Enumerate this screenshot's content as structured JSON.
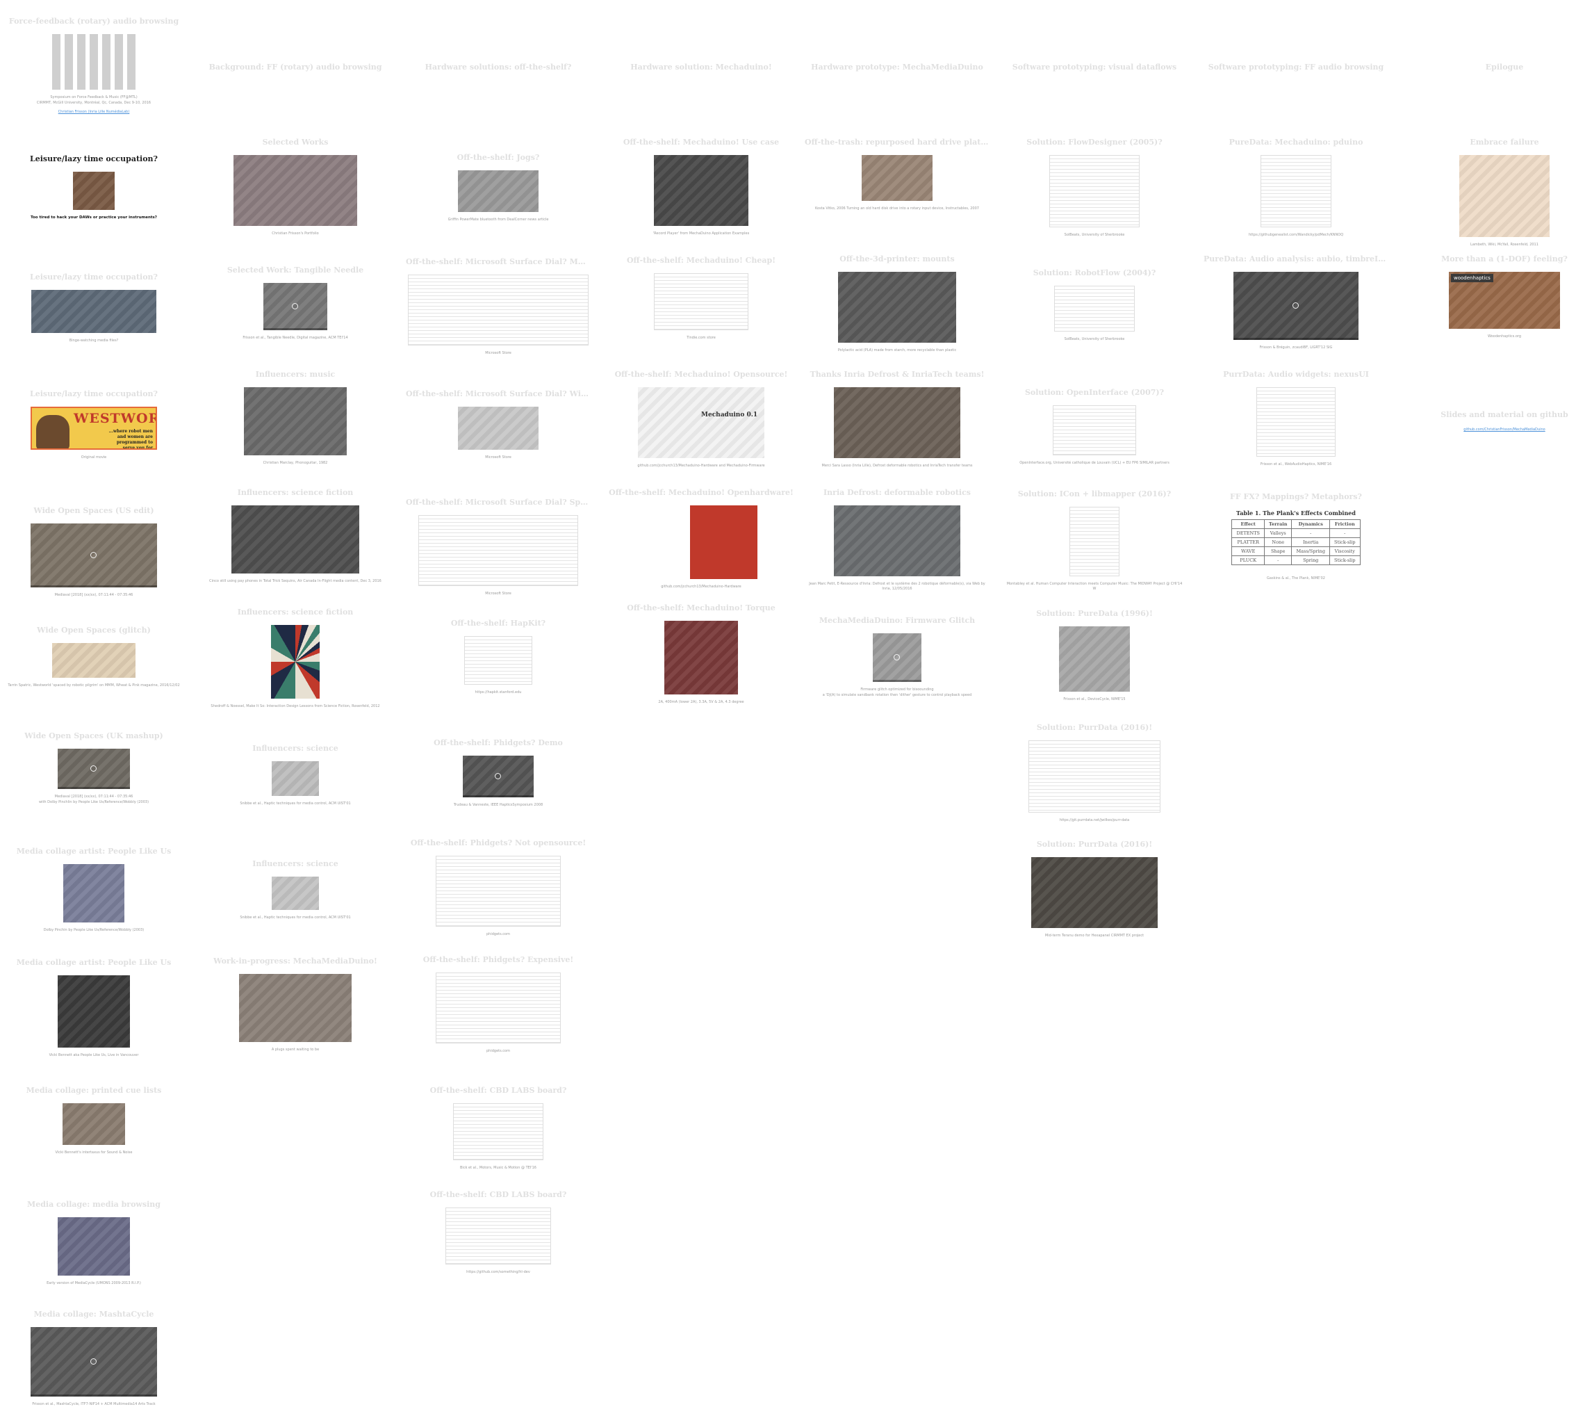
{
  "columns": [
    {
      "key": "c0",
      "cells": [
        {
          "title": "Force-feedback (rotary) audio browsing",
          "thumb": {
            "kind": "grid",
            "color": "#b8b8b8"
          },
          "caption": "Symposium on Force Feedback & Music (FF@MTL)",
          "caption2": "CIRMMT, McGill University, Montréal, Qc, Canada, Dec 9-10, 2016",
          "caption3": "Christian Frisson (Inria Lille NumédiaLab)"
        },
        {
          "title": "Leisure/lazy time occupation?",
          "title_dark": true,
          "thumb": {
            "kind": "photo",
            "color": "#7a5a44"
          },
          "caption": "Too tired to hack your DAWs or practice your instruments?",
          "caption_dark": true
        },
        {
          "title": "Leisure/lazy time occupation?",
          "thumb": {
            "kind": "photo",
            "color": "#5e6a78"
          },
          "caption": "Binge-watching media files?"
        },
        {
          "title": "Leisure/lazy time occupation?",
          "thumb": {
            "kind": "westworld",
            "color": "#f2c94c"
          },
          "ww_title": "WESTWORLD",
          "ww_tagline": "...where robot men and women are programmed to serve you for ROMANCE VIOLENCE ...ANYTHING",
          "caption": "Original movie"
        },
        {
          "title": "Wide Open Spaces (US edit)",
          "thumb": {
            "kind": "video",
            "color": "#7d7467"
          },
          "caption": "Mediaval [2018] (xx/xx), 07:11:44 - 07:35:46"
        },
        {
          "title": "Wide Open Spaces (glitch)",
          "thumb": {
            "kind": "photo",
            "color": "#e0cfb4"
          },
          "caption": "Tarrin Spatric, Westworld 'spaced by robotic pilgrim' on MMM, Wheat & Pink magazine, 2016/12/02"
        },
        {
          "title": "Wide Open Spaces (UK mashup)",
          "thumb": {
            "kind": "video",
            "color": "#6f6a63"
          },
          "caption": "Mediaval [2018] (xx/xx), 07:11:44 - 07:35:46",
          "caption2": "with Dolby Pinchlin by People Like Us/Reference/Wobbly (2003)"
        },
        {
          "title": "Media collage artist: People Like Us",
          "thumb": {
            "kind": "photo",
            "color": "#7a7e9a"
          },
          "caption": "Dolby Pinchin by People Like Us/Reference/Wobbly (2003)"
        },
        {
          "title": "Media collage artist: People Like Us",
          "thumb": {
            "kind": "photo",
            "color": "#3b3b3b"
          },
          "caption": "Vicki Bennett aka People Like Us, Live in Vancouver"
        },
        {
          "title": "Media collage: printed cue lists",
          "thumb": {
            "kind": "photo",
            "color": "#8a7c70"
          },
          "caption": "Vicki Bennett's intertaxus for Sound & Noise"
        },
        {
          "title": "Media collage: media browsing",
          "thumb": {
            "kind": "photo",
            "color": "#6a6c88"
          },
          "caption": "Early version of MediaCycle (UMONS 2009-2013 R.I.P.)"
        },
        {
          "title": "Media collage: MashtaCycle",
          "thumb": {
            "kind": "video",
            "color": "#5a5a5a"
          },
          "caption": "Frisson et al., MashtaCycle, ITF7-NIF14 + ACM Multimedia14 Arts Track"
        }
      ]
    },
    {
      "key": "c1",
      "cells": [
        {
          "title": "Background: FF (rotary) audio browsing",
          "thumb": null,
          "caption": ""
        },
        {
          "title": "Selected Works",
          "thumb": {
            "kind": "collage",
            "color": "#8c7d80"
          },
          "caption": "Christian Frisson's Portfolio"
        },
        {
          "title": "Selected Work: Tangible Needle",
          "thumb": {
            "kind": "video",
            "color": "#777777"
          },
          "caption": "Frisson et al., Tangible Needle, Digital magazine, ACM TEI'14"
        },
        {
          "title": "Influencers: music",
          "thumb": {
            "kind": "photo",
            "color": "#6a6a6a"
          },
          "caption": "Christian Marclay, Phonoguitar, 1982"
        },
        {
          "title": "Influencers: science fiction",
          "thumb": {
            "kind": "photo",
            "color": "#4f4f4f"
          },
          "caption": "Cinco still using pay phones in Total Trick Sequins, Air Canada In-Flight media content, Dec 3, 2016"
        },
        {
          "title": "Influencers: science fiction",
          "thumb": {
            "kind": "burst",
            "color": "#c26a6a"
          },
          "caption": "Shedroff & Noessel, Make It So: Interaction Design Lessons from Science Fiction, Rosenfeld, 2012"
        },
        {
          "title": "Influencers: science",
          "thumb": {
            "kind": "photo",
            "color": "#bdbdbd"
          },
          "caption": "Snibbe et al., Haptic techniques for media control, ACM UIST'01"
        },
        {
          "title": "Influencers: science",
          "thumb": {
            "kind": "photo",
            "color": "#c4c4c4"
          },
          "caption": "Snibbe et al., Haptic techniques for media control, ACM UIST'01"
        },
        {
          "title": "Work-in-progress: MechaMediaDuino!",
          "thumb": {
            "kind": "photo",
            "color": "#8b8178"
          },
          "caption": "A plugs spent waiting to be"
        }
      ]
    },
    {
      "key": "c2",
      "cells": [
        {
          "title": "Hardware solutions: off-the-shelf?",
          "thumb": null,
          "caption": ""
        },
        {
          "title": "Off-the-shelf: Jogs?",
          "thumb": {
            "kind": "photo",
            "color": "#9a9a9a"
          },
          "caption": "Griffin PowerMate bluetooth from DealCorner news article"
        },
        {
          "title": "Off-the-shelf: Microsoft Surface Dial? Monolith",
          "thumb": {
            "kind": "web",
            "color": "#e8e8e8"
          },
          "caption": "Microsoft Store"
        },
        {
          "title": "Off-the-shelf: Microsoft Surface Dial? With hands",
          "thumb": {
            "kind": "photo",
            "color": "#c8c8c8"
          },
          "caption": "Microsoft Store"
        },
        {
          "title": "Off-the-shelf: Microsoft Surface Dial? Specs",
          "thumb": {
            "kind": "doc",
            "color": "#f0f0f0"
          },
          "caption": "Microsoft Store"
        },
        {
          "title": "Off-the-shelf: HapKit?",
          "thumb": {
            "kind": "doc",
            "color": "#eeeeee"
          },
          "caption": "https://hapkit.stanford.edu"
        },
        {
          "title": "Off-the-shelf: Phidgets? Demo",
          "thumb": {
            "kind": "video",
            "color": "#555555"
          },
          "caption": "Trudeau & Vanneste, IEEE HapticsSymposium 2008"
        },
        {
          "title": "Off-the-shelf: Phidgets? Not opensource!",
          "thumb": {
            "kind": "doc",
            "color": "#e6e6e6"
          },
          "caption": "phidgets.com"
        },
        {
          "title": "Off-the-shelf: Phidgets? Expensive!",
          "thumb": {
            "kind": "doc",
            "color": "#e6e6e6"
          },
          "caption": "phidgets.com"
        },
        {
          "title": "Off-the-shelf: CBD LABS board?",
          "thumb": {
            "kind": "doc",
            "color": "#f0f0f0"
          },
          "caption": "Bick et al., Motors, Music & Motion @ TEI'16"
        },
        {
          "title": "Off-the-shelf: CBD LABS board?",
          "thumb": {
            "kind": "doc",
            "color": "#f4f4f4"
          },
          "caption": "https://github.com/something/hl-dev"
        }
      ]
    },
    {
      "key": "c3",
      "cells": [
        {
          "title": "Hardware solution: Mechaduino!",
          "thumb": null,
          "caption": ""
        },
        {
          "title": "Off-the-shelf: Mechaduino! Use case",
          "thumb": {
            "kind": "photo",
            "color": "#4a4a4a"
          },
          "caption": "'Record Player' from MechaDuino Application Examples"
        },
        {
          "title": "Off-the-shelf: Mechaduino! Cheap!",
          "thumb": {
            "kind": "web",
            "color": "#ececec"
          },
          "caption": "Tindie.com store"
        },
        {
          "title": "Off-the-shelf: Mechaduino! Opensource!",
          "thumb": {
            "kind": "mechaduino",
            "color": "#f2f2f2"
          },
          "badge": "Mechaduino 0.1",
          "caption": "github.com/jcchurch13/Mechaduino-Hardware and Mechaduino-Firmware"
        },
        {
          "title": "Off-the-shelf: Mechaduino! Openhardware!",
          "thumb": {
            "kind": "pcb",
            "color": "#c0392b"
          },
          "caption": "github.com/jcchurch13/Mechaduino-Hardware"
        },
        {
          "title": "Off-the-shelf: Mechaduino! Torque",
          "thumb": {
            "kind": "photo",
            "color": "#7a3a3a"
          },
          "caption": "2A, 400mA (lower 2A), 3.3A, 5V & 2A, 4.3 degree"
        }
      ]
    },
    {
      "key": "c4",
      "cells": [
        {
          "title": "Hardware prototype: MechaMediaDuino",
          "thumb": null,
          "caption": ""
        },
        {
          "title": "Off-the-trash: repurposed hard drive platter",
          "thumb": {
            "kind": "photo",
            "color": "#9a8676"
          },
          "caption": "Kosta Vitko, 2006 Turning an old hard disk drive into a rotary input device, Instructables, 2007"
        },
        {
          "title": "Off-the-3d-printer: mounts",
          "thumb": {
            "kind": "render",
            "color": "#5a5a5a"
          },
          "caption": "Polylactic acid (PLA) made from starch, more recyclable than plastic"
        },
        {
          "title": "Thanks Inria Defrost & InriaTech teams!",
          "thumb": {
            "kind": "photo",
            "color": "#6b6157"
          },
          "caption": "Merci Sara Lasso (Inria Lille), Defrost deformable robotics and InriaTech transfer teams"
        },
        {
          "title": "Inria Defrost: deformable robotics",
          "thumb": {
            "kind": "photo",
            "color": "#6a6d70"
          },
          "caption": "Jean Marc Petit, E-Ressource d'Inria: Defrost et le système des 2 robotique déformable(s), via Web by Inria, 12/05/2016"
        },
        {
          "title": "MechaMediaDuino: Firmware Glitch",
          "thumb": {
            "kind": "video",
            "color": "#9c9c9c"
          },
          "caption": "Firmware glitch optimized for bisoounding",
          "caption2": "a 'DJ(A) to simulate sandbank rotation then 'dither' gesture to control playback speed"
        }
      ]
    },
    {
      "key": "c5",
      "cells": [
        {
          "title": "Software prototyping: visual dataflows",
          "thumb": null,
          "caption": ""
        },
        {
          "title": "Solution: FlowDesigner (2005)?",
          "thumb": {
            "kind": "doc",
            "color": "#f3f3f3"
          },
          "caption": "SolBeats, University of Sherbrooke"
        },
        {
          "title": "Solution: RobotFlow (2004)?",
          "thumb": {
            "kind": "doc",
            "color": "#d9e6d0"
          },
          "caption": "SolBeats, University of Sherbrooke"
        },
        {
          "title": "Solution: OpenInterface (2007)?",
          "thumb": {
            "kind": "doc",
            "color": "#d5dde8"
          },
          "caption": "OpenInterface.org, Université catholique de Louvain (UCL) + EU FP6 SIMILAR partners"
        },
        {
          "title": "Solution: ICon + libmapper (2016)?",
          "thumb": {
            "kind": "doc",
            "color": "#ececf5"
          },
          "caption": "Montabley et al. Human Computer Interaction meets Computer Music: The MIDWAY Project @ CHI'14 W"
        },
        {
          "title": "Solution: PureData (1996)!",
          "thumb": {
            "kind": "collage",
            "color": "#a8a8a8"
          },
          "caption": "Frisson et al., DeviceCycle, NIME'15"
        },
        {
          "title": "Solution: PurrData (2016)!",
          "thumb": {
            "kind": "doc",
            "color": "#f5f5f5"
          },
          "caption": "https://git.purrdata.net/jwilkes/purr-data"
        },
        {
          "title": "Solution: PurrData (2016)!",
          "thumb": {
            "kind": "photo",
            "color": "#4e4a44"
          },
          "caption": "Mid-term Teranu demo for Hexapanel CIRMMT EX project"
        }
      ]
    },
    {
      "key": "c6",
      "cells": [
        {
          "title": "Software prototyping: FF audio browsing",
          "thumb": null,
          "caption": ""
        },
        {
          "title": "PureData: Mechaduino: pduino",
          "thumb": {
            "kind": "doc",
            "color": "#d9eef0"
          },
          "caption": "https://githubgenealist.com/Wandicky/pdMech/KNNOQ"
        },
        {
          "title": "PureData: Audio analysis: aubio, timbreID...",
          "thumb": {
            "kind": "video",
            "color": "#4e4e4e"
          },
          "caption": "Frisson & Bréguin, zcaudiBF, LIGRT'12 SIG"
        },
        {
          "title": "PurrData: Audio widgets: nexusUI",
          "thumb": {
            "kind": "doc",
            "color": "#f5f5f5"
          },
          "caption": "Frisson et al., WebAudioHaptics, NIME'16"
        },
        {
          "title": "FF FX? Mappings? Metaphors?",
          "thumb": {
            "kind": "table",
            "color": "#ffffff"
          },
          "caption": "Gaskins & al., The Plank, NIME'02"
        }
      ]
    },
    {
      "key": "c7",
      "cells": [
        {
          "title": "Epilogue",
          "thumb": null,
          "caption": ""
        },
        {
          "title": "Embrace failure",
          "thumb": {
            "kind": "poster",
            "color": "#efdcc8"
          },
          "caption": "Lambeth, Wiki, McYail, Rosenfeld, 2011"
        },
        {
          "title": "More than a (1-DOF) feeling?",
          "thumb": {
            "kind": "photo",
            "color": "#9a6a4a"
          },
          "badge": "woodenhaptics",
          "caption": "Woodenhaptics.org"
        },
        {
          "title": "Slides and material on github",
          "thumb": null,
          "caption": "github.com/ChristianFrisson/MechaMediaDuino"
        }
      ]
    }
  ],
  "fx_table": {
    "caption": "Table 1. The Plank's Effects Combined",
    "headers": [
      "Effect",
      "Terrain",
      "Dynamics",
      "Friction"
    ],
    "rows": [
      [
        "DETENTS",
        "Valleys",
        "-",
        "-"
      ],
      [
        "PLATTER",
        "None",
        "Inertia",
        "Stick-slip"
      ],
      [
        "WAVE",
        "Shape",
        "Mass/Spring",
        "Viscosity"
      ],
      [
        "PLUCK",
        "-",
        "Spring",
        "Stick-slip"
      ]
    ]
  }
}
